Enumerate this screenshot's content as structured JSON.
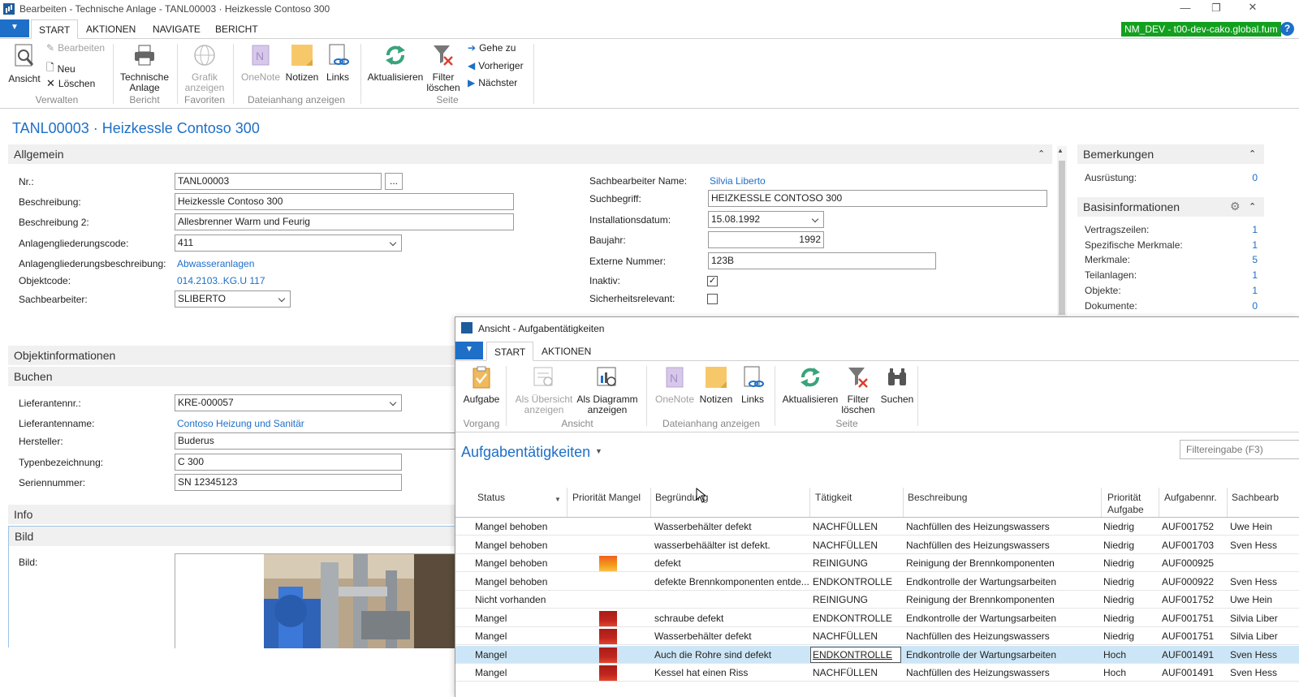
{
  "window": {
    "title": "Bearbeiten - Technische Anlage - TANL00003 · Heizkessle Contoso 300",
    "minimize": "—",
    "restore": "❐",
    "close": "✕"
  },
  "menu": {
    "tabs": [
      "START",
      "AKTIONEN",
      "NAVIGATE",
      "BERICHT"
    ],
    "env": "NM_DEV - t00-dev-cako.global.fum",
    "help": "?"
  },
  "ribbon": {
    "ansicht": "Ansicht",
    "bearbeiten": "Bearbeiten",
    "neu": "Neu",
    "loeschen": "Löschen",
    "g_verwalten": "Verwalten",
    "technische": "Technische",
    "anlage": "Anlage",
    "g_bericht": "Bericht",
    "grafik": "Grafik",
    "anzeigen": "anzeigen",
    "g_favoriten": "Favoriten",
    "onenote": "OneNote",
    "notizen": "Notizen",
    "links": "Links",
    "g_dateianhang": "Dateianhang anzeigen",
    "aktualisieren": "Aktualisieren",
    "filter": "Filter",
    "loeschen2": "löschen",
    "g_seite": "Seite",
    "gehezu": "Gehe zu",
    "vorheriger": "Vorheriger",
    "naechster": "Nächster"
  },
  "page": {
    "title": "TANL00003 · Heizkessle Contoso 300"
  },
  "allgemein": {
    "title": "Allgemein",
    "nr_label": "Nr.:",
    "nr": "TANL00003",
    "assist": "...",
    "beschr_label": "Beschreibung:",
    "beschr": "Heizkessle Contoso 300",
    "beschr2_label": "Beschreibung 2:",
    "beschr2": "Allesbrenner Warm und Feurig",
    "agc_label": "Anlagengliederungscode:",
    "agc": "411",
    "agb_label": "Anlagengliederungsbeschreibung:",
    "agb": "Abwasseranlagen",
    "objcode_label": "Objektcode:",
    "objcode": "014.2103..KG.U 117",
    "sachb_label": "Sachbearbeiter:",
    "sachb": "SLIBERTO",
    "sbname_label": "Sachbearbeiter Name:",
    "sbname": "Silvia Liberto",
    "such_label": "Suchbegriff:",
    "such": "HEIZKESSLE CONTOSO 300",
    "inst_label": "Installationsdatum:",
    "inst": "15.08.1992",
    "baujahr_label": "Baujahr:",
    "baujahr": "1992",
    "extnr_label": "Externe Nummer:",
    "extnr": "123B",
    "inaktiv_label": "Inaktiv:",
    "inaktiv_check": "✓",
    "sicher_label": "Sicherheitsrelevant:"
  },
  "objekt": {
    "title": "Objektinformationen"
  },
  "buchen": {
    "title": "Buchen",
    "liefnr_label": "Lieferantennr.:",
    "liefnr": "KRE-000057",
    "liefname_label": "Lieferantenname:",
    "liefname": "Contoso Heizung und Sanitär",
    "herst_label": "Hersteller:",
    "herst": "Buderus",
    "typ_label": "Typenbezeichnung:",
    "typ": "C 300",
    "serie_label": "Seriennummer:",
    "serie": "SN 12345123"
  },
  "info": {
    "title": "Info"
  },
  "bild": {
    "title": "Bild",
    "label": "Bild:"
  },
  "factbox": {
    "bemerkungen": "Bemerkungen",
    "ausruestung_label": "Ausrüstung:",
    "ausruestung": "0",
    "basis": "Basisinformationen",
    "items": [
      {
        "label": "Vertragszeilen:",
        "value": "1"
      },
      {
        "label": "Spezifische Merkmale:",
        "value": "1"
      },
      {
        "label": "Merkmale:",
        "value": "5"
      },
      {
        "label": "Teilanlagen:",
        "value": "1"
      },
      {
        "label": "Objekte:",
        "value": "1"
      },
      {
        "label": "Dokumente:",
        "value": "0"
      }
    ]
  },
  "popup": {
    "title": "Ansicht - Aufgabentätigkeiten",
    "tabs": [
      "START",
      "AKTIONEN"
    ],
    "ribbon": {
      "aufgabe": "Aufgabe",
      "g_vorgang": "Vorgang",
      "als_ueb1": "Als Übersicht",
      "als_ueb2": "anzeigen",
      "als_dia1": "Als Diagramm",
      "als_dia2": "anzeigen",
      "g_ansicht": "Ansicht",
      "onenote": "OneNote",
      "notizen": "Notizen",
      "links": "Links",
      "g_dateianhang": "Dateianhang anzeigen",
      "aktualisieren": "Aktualisieren",
      "filter": "Filter",
      "loeschen": "löschen",
      "suchen": "Suchen",
      "g_seite": "Seite"
    },
    "list_title": "Aufgabentätigkeiten",
    "filter_placeholder": "Filtereingabe (F3)",
    "columns": {
      "status": "Status",
      "prio": "Priorität Mangel",
      "begr": "Begründung",
      "taet": "Tätigkeit",
      "beschr": "Beschreibung",
      "prioauf1": "Priorität",
      "prioauf2": "Aufgabe",
      "aufnr": "Aufgabennr.",
      "sachb": "Sachbearb"
    },
    "rows": [
      {
        "status": "Mangel behoben",
        "prio": "",
        "begr": "Wasserbehälter defekt",
        "taet": "NACHFÜLLEN",
        "beschr": "Nachfüllen des Heizungswassers",
        "prioauf": "Niedrig",
        "aufnr": "AUF001752",
        "sachb": "Uwe Hein"
      },
      {
        "status": "Mangel behoben",
        "prio": "",
        "begr": "wasserbehäälter ist defekt.",
        "taet": "NACHFÜLLEN",
        "beschr": "Nachfüllen des Heizungswassers",
        "prioauf": "Niedrig",
        "aufnr": "AUF001703",
        "sachb": "Sven Hess"
      },
      {
        "status": "Mangel behoben",
        "prio": "orange",
        "begr": "defekt",
        "taet": "REINIGUNG",
        "beschr": "Reinigung der Brennkomponenten",
        "prioauf": "Niedrig",
        "aufnr": "AUF000925",
        "sachb": ""
      },
      {
        "status": "Mangel behoben",
        "prio": "",
        "begr": "defekte Brennkomponenten entde...",
        "taet": "ENDKONTROLLE",
        "beschr": "Endkontrolle der Wartungsarbeiten",
        "prioauf": "Niedrig",
        "aufnr": "AUF000922",
        "sachb": "Sven Hess"
      },
      {
        "status": "Nicht vorhanden",
        "prio": "",
        "begr": "",
        "taet": "REINIGUNG",
        "beschr": "Reinigung der Brennkomponenten",
        "prioauf": "Niedrig",
        "aufnr": "AUF001752",
        "sachb": "Uwe Hein"
      },
      {
        "status": "Mangel",
        "prio": "red",
        "begr": "schraube defekt",
        "taet": "ENDKONTROLLE",
        "beschr": "Endkontrolle der Wartungsarbeiten",
        "prioauf": "Niedrig",
        "aufnr": "AUF001751",
        "sachb": "Silvia Liber"
      },
      {
        "status": "Mangel",
        "prio": "red",
        "begr": "Wasserbehälter defekt",
        "taet": "NACHFÜLLEN",
        "beschr": "Nachfüllen des Heizungswassers",
        "prioauf": "Niedrig",
        "aufnr": "AUF001751",
        "sachb": "Silvia Liber"
      },
      {
        "status": "Mangel",
        "prio": "red",
        "begr": "Auch die Rohre sind defekt",
        "taet": "ENDKONTROLLE",
        "beschr": "Endkontrolle der Wartungsarbeiten",
        "prioauf": "Hoch",
        "aufnr": "AUF001491",
        "sachb": "Sven Hess"
      },
      {
        "status": "Mangel",
        "prio": "red",
        "begr": "Kessel hat einen Riss",
        "taet": "NACHFÜLLEN",
        "beschr": "Nachfüllen des Heizungswassers",
        "prioauf": "Hoch",
        "aufnr": "AUF001491",
        "sachb": "Sven Hess"
      }
    ]
  },
  "colors": {
    "accent": "#1e6fc7",
    "env": "#13a01f",
    "selected_row": "#cde6f7",
    "prio_red": "#c0261e",
    "prio_orange": "#f39a1c"
  }
}
